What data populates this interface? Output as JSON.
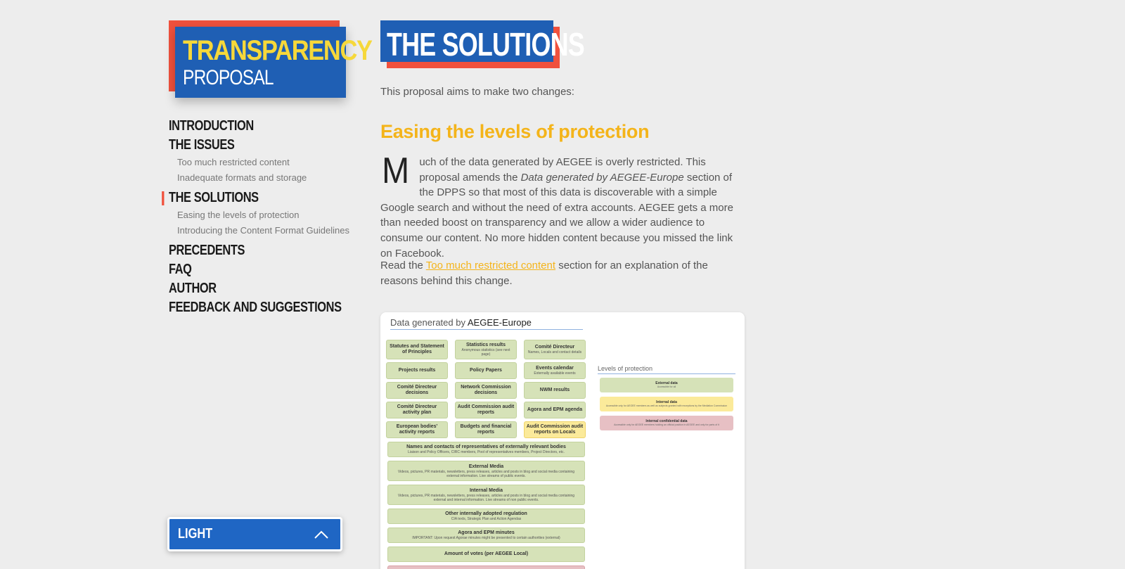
{
  "logo": {
    "line1": "TRANSPARENCY",
    "line2": "PROPOSAL"
  },
  "nav": {
    "items": [
      {
        "label": "INTRODUCTION"
      },
      {
        "label": "THE ISSUES",
        "subs": [
          "Too much restricted content",
          "Inadequate formats and storage"
        ]
      },
      {
        "label": "THE SOLUTIONS",
        "active": true,
        "subs": [
          "Easing the levels of protection",
          "Introducing the Content Format Guidelines"
        ]
      },
      {
        "label": "PRECEDENTS"
      },
      {
        "label": "FAQ"
      },
      {
        "label": "AUTHOR"
      },
      {
        "label": "FEEDBACK AND SUGGESTIONS"
      }
    ]
  },
  "theme": {
    "selected": "LIGHT"
  },
  "content": {
    "title": "THE SOLUTIONS",
    "intro": "This proposal aims to make two changes:",
    "section_heading": "Easing the levels of protection",
    "dropcap": "M",
    "para1_a": "uch of the data generated by AEGEE is overly restricted. This proposal amends the ",
    "para1_em": "Data generated by AEGEE-Europe",
    "para1_b": " section of the DPPS so that most of this data is discoverable with a simple Google search and without the need of extra accounts. AEGEE gets a more than needed boost on transparency and we allow a wider audience to consume our content. No more hidden content because you missed the link on Facebook.",
    "para2_a": "Read the ",
    "para2_link": "Too much restricted content",
    "para2_b": " section for an explanation of the reasons behind this change."
  },
  "figure": {
    "heading_prefix": "Data generated by ",
    "heading_org": "AEGEE-Europe",
    "cells": [
      {
        "title": "Statutes and Statement of Principles",
        "sub": ""
      },
      {
        "title": "Statistics results",
        "sub": "Anonymous statistics (see next page)"
      },
      {
        "title": "Comité Directeur",
        "sub": "Names, Locals and contact details"
      },
      {
        "title": "Projects results",
        "sub": ""
      },
      {
        "title": "Policy Papers",
        "sub": ""
      },
      {
        "title": "Events calendar",
        "sub": "Externally available events"
      },
      {
        "title": "Comité Directeur decisions",
        "sub": ""
      },
      {
        "title": "Network Commission decisions",
        "sub": ""
      },
      {
        "title": "NWM results",
        "sub": ""
      },
      {
        "title": "Comité Directeur activity plan",
        "sub": ""
      },
      {
        "title": "Audit Commission audit reports",
        "sub": ""
      },
      {
        "title": "Agora and EPM agenda",
        "sub": ""
      },
      {
        "title": "European bodies' activity reports",
        "sub": ""
      },
      {
        "title": "Budgets and financial reports",
        "sub": ""
      },
      {
        "title": "Audit Commission audit reports on Locals",
        "sub": "",
        "level": "internal"
      }
    ],
    "rows": [
      {
        "title": "Names and contacts of representatives of externally relevant bodies",
        "sub": "Liaison and Policy Officers, CIRC members, Pool of representatives members, Project Directors, etc."
      },
      {
        "title": "External Media",
        "sub": "Videos, pictures, PR materials, newsletters, press releases, articles and posts in blog and social media containing external information. Live streams of public events."
      },
      {
        "title": "Internal Media",
        "sub": "Videos, pictures, PR materials, newsletters, press releases, articles and posts in blog and social media containing external and internal information. Live streams of non public events."
      },
      {
        "title": "Other internally adopted regulation",
        "sub": "CIA texts, Strategic Plan and Action Agendas"
      },
      {
        "title": "Agora and EPM minutes",
        "sub": "IMPORTANT: Upon request Agorae minutes might be presented to certain authorities (external)"
      },
      {
        "title": "Amount of votes (per AEGEE Local)",
        "sub": ""
      }
    ],
    "levels_title": "Levels of protection",
    "levels": [
      {
        "title": "External data",
        "sub": "Accessible for all",
        "kind": "g"
      },
      {
        "title": "Internal data",
        "sub": "Accessible only for AEGEE members as well as subjects granted with exceptions by the Mediation Commission",
        "kind": "y"
      },
      {
        "title": "Internal confidential data",
        "sub": "Accessible only for AEGEE members holding an official position in AEGEE and only for parts of it",
        "kind": "p"
      }
    ],
    "colors": {
      "external": "#d6e2b8",
      "internal": "#fbea9a",
      "confidential": "#e7c0c4"
    }
  },
  "colors": {
    "accent_blue": "#1f5fb4",
    "accent_red": "#f0513d",
    "accent_yellow": "#f4b41a"
  }
}
